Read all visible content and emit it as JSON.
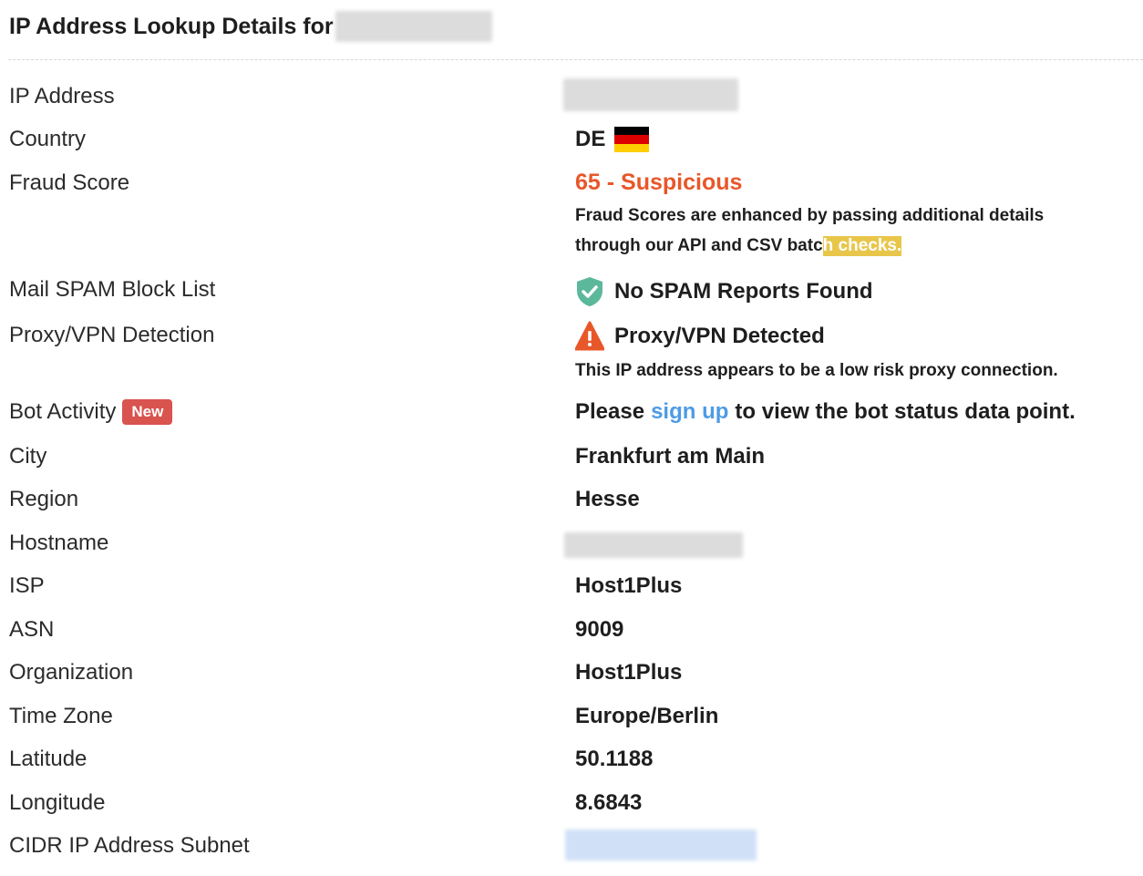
{
  "header": {
    "title": "IP Address Lookup Details for"
  },
  "labels": {
    "ip": "IP Address",
    "country": "Country",
    "fraud": "Fraud Score",
    "spam": "Mail SPAM Block List",
    "proxy": "Proxy/VPN Detection",
    "bot": "Bot Activity",
    "bot_badge": "New",
    "city": "City",
    "region": "Region",
    "hostname": "Hostname",
    "isp": "ISP",
    "asn": "ASN",
    "org": "Organization",
    "tz": "Time Zone",
    "lat": "Latitude",
    "lon": "Longitude",
    "cidr": "CIDR IP Address Subnet"
  },
  "values": {
    "country_code": "DE",
    "fraud_score": "65 - Suspicious",
    "fraud_note_1": "Fraud Scores are enhanced by passing additional details",
    "fraud_note_2a": "through our API and CSV batc",
    "fraud_note_2b": "h checks.",
    "spam": "No SPAM Reports Found",
    "proxy": "Proxy/VPN Detected",
    "proxy_note": "This IP address appears to be a low risk proxy connection.",
    "bot_pre": "Please",
    "bot_link": "sign up",
    "bot_post": "to view the bot status data point.",
    "city": "Frankfurt am Main",
    "region": "Hesse",
    "isp": "Host1Plus",
    "asn": "9009",
    "org": "Host1Plus",
    "tz": "Europe/Berlin",
    "lat": "50.1188",
    "lon": "8.6843"
  },
  "colors": {
    "fraud": "#e8572a",
    "link": "#4d9be6",
    "badge": "#d9534f",
    "highlight": "#e8c64a",
    "shield": "#5cb89a",
    "warning": "#e8572a"
  },
  "icons": {
    "flag": "germany-flag-icon",
    "spam": "shield-check-icon",
    "proxy": "warning-triangle-icon"
  }
}
